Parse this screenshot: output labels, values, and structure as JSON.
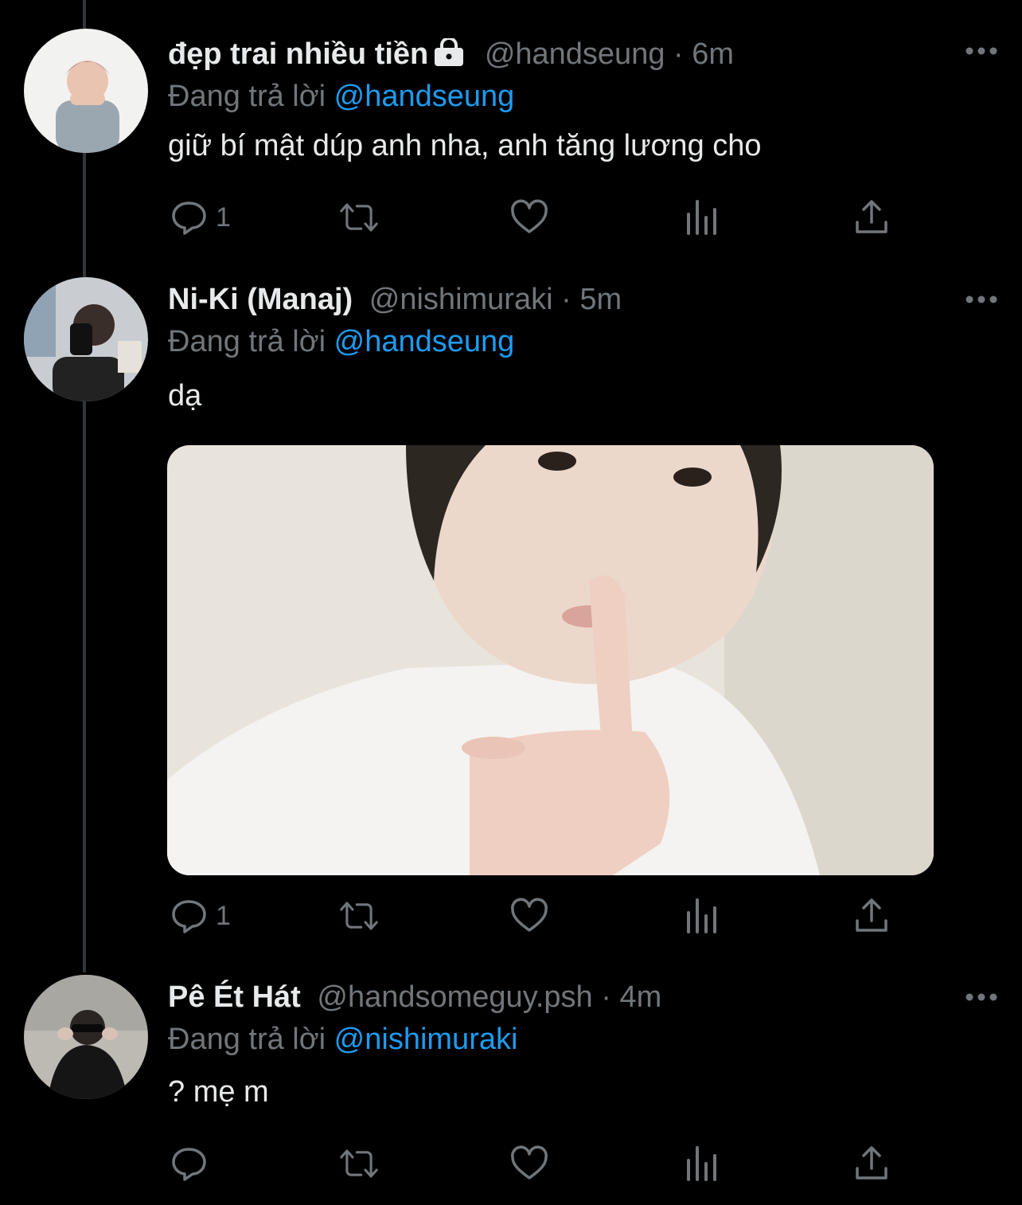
{
  "tweets": [
    {
      "display_name": "đẹp trai nhiều tiền",
      "locked": true,
      "handle": "@handseung",
      "time": "6m",
      "reply_prefix": "Đang trả lời",
      "reply_to": "@handseung",
      "text": "giữ bí mật dúp anh nha, anh tăng lương cho",
      "reply_count": "1",
      "avatar_icon": "user-avatar"
    },
    {
      "display_name": "Ni-Ki (Manaj)",
      "locked": false,
      "handle": "@nishimuraki",
      "time": "5m",
      "reply_prefix": "Đang trả lời",
      "reply_to": "@handseung",
      "text": "dạ",
      "reply_count": "1",
      "has_media": true,
      "avatar_icon": "user-avatar"
    },
    {
      "display_name": "Pê Ét Hát",
      "locked": false,
      "handle": "@handsomeguy.psh",
      "time": "4m",
      "reply_prefix": "Đang trả lời",
      "reply_to": "@nishimuraki",
      "text": "? mẹ m",
      "reply_count": "",
      "avatar_icon": "user-avatar"
    }
  ],
  "separator": "·",
  "colors": {
    "background": "#000000",
    "text": "#e7e9ea",
    "muted": "#71767b",
    "accent": "#1d9bf0"
  }
}
